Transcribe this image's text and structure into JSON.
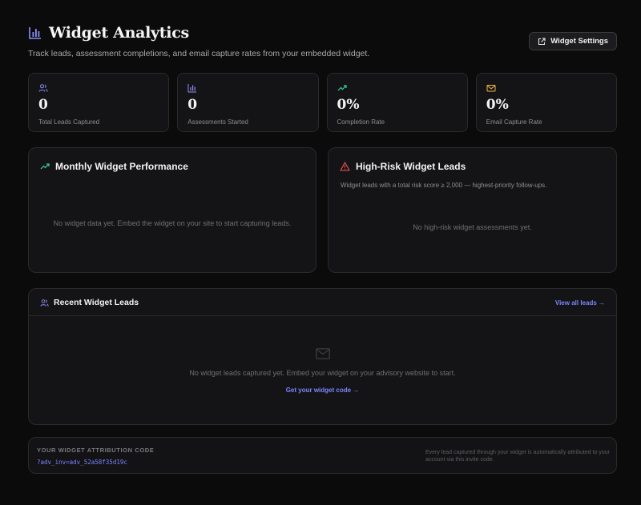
{
  "header": {
    "title": "Widget Analytics",
    "subtitle": "Track leads, assessment completions, and email capture rates from your embedded widget.",
    "settings_label": "Widget Settings"
  },
  "stats": [
    {
      "icon": "users-icon",
      "value": "0",
      "label": "Total Leads Captured",
      "color": "#8b8ff7"
    },
    {
      "icon": "bar-chart-icon",
      "value": "0",
      "label": "Assessments Started",
      "color": "#8b8ff7"
    },
    {
      "icon": "trending-up-icon",
      "value": "0%",
      "label": "Completion Rate",
      "color": "#34d399"
    },
    {
      "icon": "mail-icon",
      "value": "0%",
      "label": "Email Capture Rate",
      "color": "#f5b83d"
    }
  ],
  "performance": {
    "title": "Monthly Widget Performance",
    "empty": "No widget data yet. Embed the widget on your site to start capturing leads."
  },
  "high_risk": {
    "title": "High-Risk Widget Leads",
    "description": "Widget leads with a total risk score ≥ 2,000 — highest-priority follow-ups.",
    "empty": "No high-risk widget assessments yet."
  },
  "recent_leads": {
    "title": "Recent Widget Leads",
    "view_all": "View all leads →",
    "empty": "No widget leads captured yet. Embed your widget on your advisory website to start.",
    "cta": "Get your widget code →"
  },
  "attribution": {
    "label": "YOUR WIDGET ATTRIBUTION CODE",
    "code": "?adv_inv=adv_52a58f35d19c",
    "note": "Every lead captured through your widget is automatically attributed to your account via this invite code."
  },
  "colors": {
    "accent": "#7c84ff",
    "success": "#34d399",
    "warning": "#f5b83d",
    "danger": "#ef5350"
  }
}
